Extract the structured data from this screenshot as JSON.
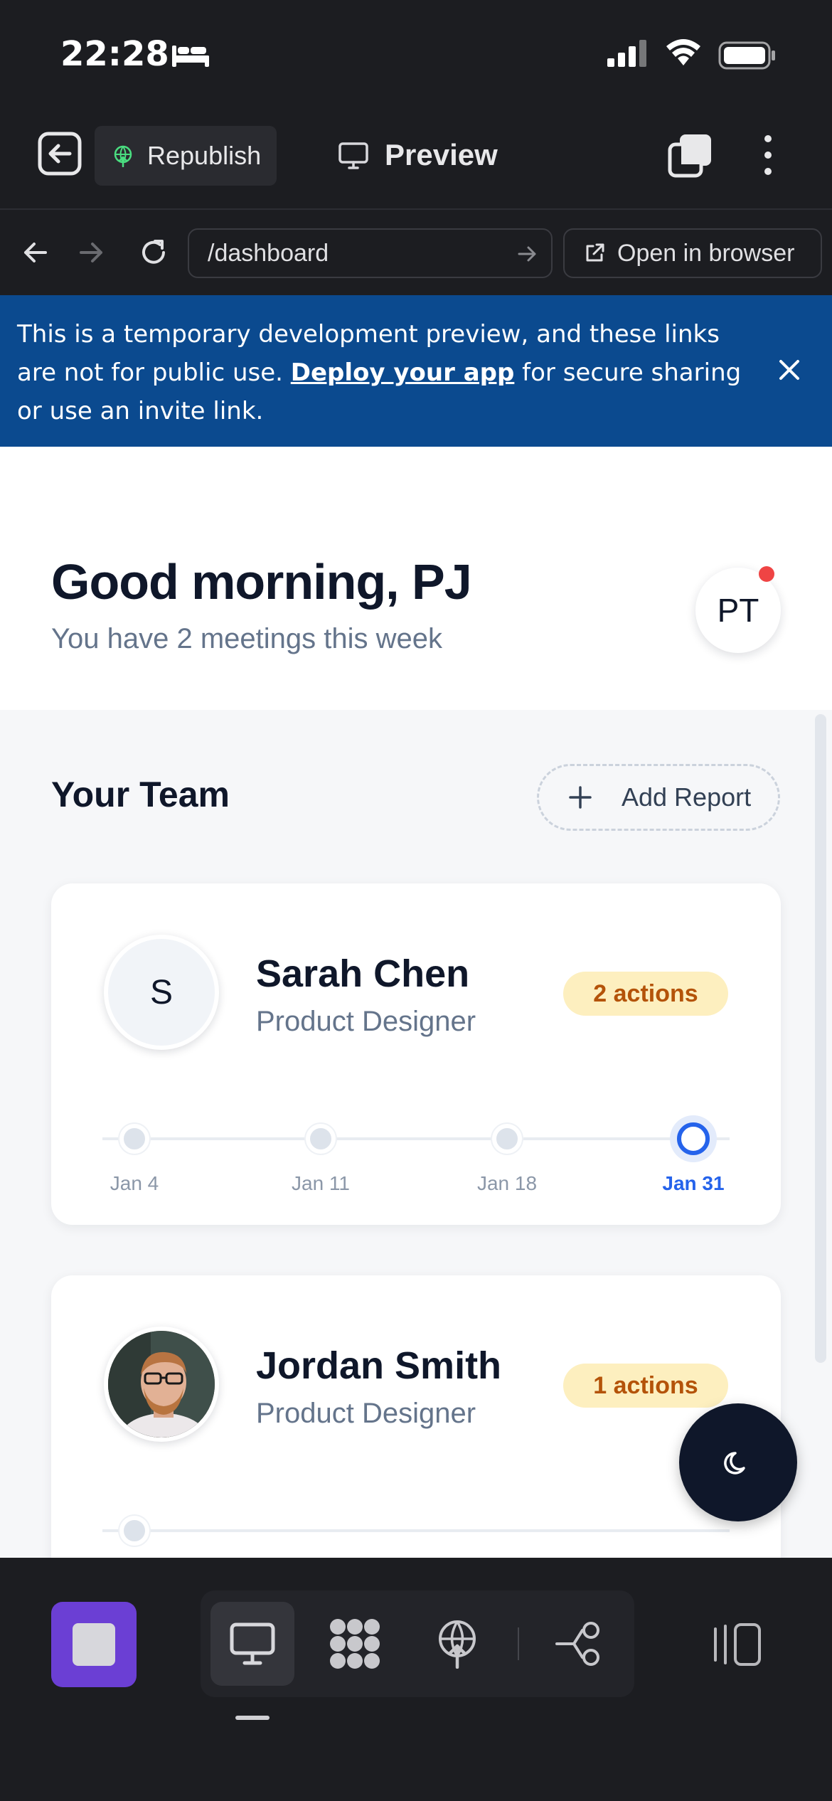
{
  "status": {
    "time": "22:28"
  },
  "toolbar": {
    "republish_label": "Republish",
    "preview_label": "Preview"
  },
  "urlbar": {
    "url": "/dashboard",
    "open_browser_label": "Open in browser"
  },
  "banner": {
    "text_before": "This is a temporary development preview, and these links are not for public use. ",
    "link_text": "Deploy your app",
    "text_after": " for secure sharing or use an invite link."
  },
  "greeting": {
    "title": "Good morning, PJ",
    "subtitle": "You have 2 meetings this week",
    "avatar_initials": "PT"
  },
  "team": {
    "title": "Your Team",
    "add_report_label": "Add Report",
    "members": [
      {
        "initial": "S",
        "name": "Sarah Chen",
        "role": "Product Designer",
        "actions": "2 actions",
        "timeline": [
          "Jan 4",
          "Jan 11",
          "Jan 18",
          "Jan 31"
        ],
        "active_date": "Jan 31"
      },
      {
        "initial": "",
        "name": "Jordan Smith",
        "role": "Product Designer",
        "actions": "1 actions"
      }
    ]
  },
  "icons": {
    "theme": "moon-icon",
    "exit": "exit-icon",
    "republish": "globe-upload-icon",
    "preview": "monitor-icon"
  },
  "colors": {
    "banner": "#0b4a8f",
    "accent": "#2563eb",
    "badge_bg": "#fdefbf",
    "badge_text": "#b45309",
    "app_square": "#6b3fd4",
    "notification": "#ef4444"
  }
}
